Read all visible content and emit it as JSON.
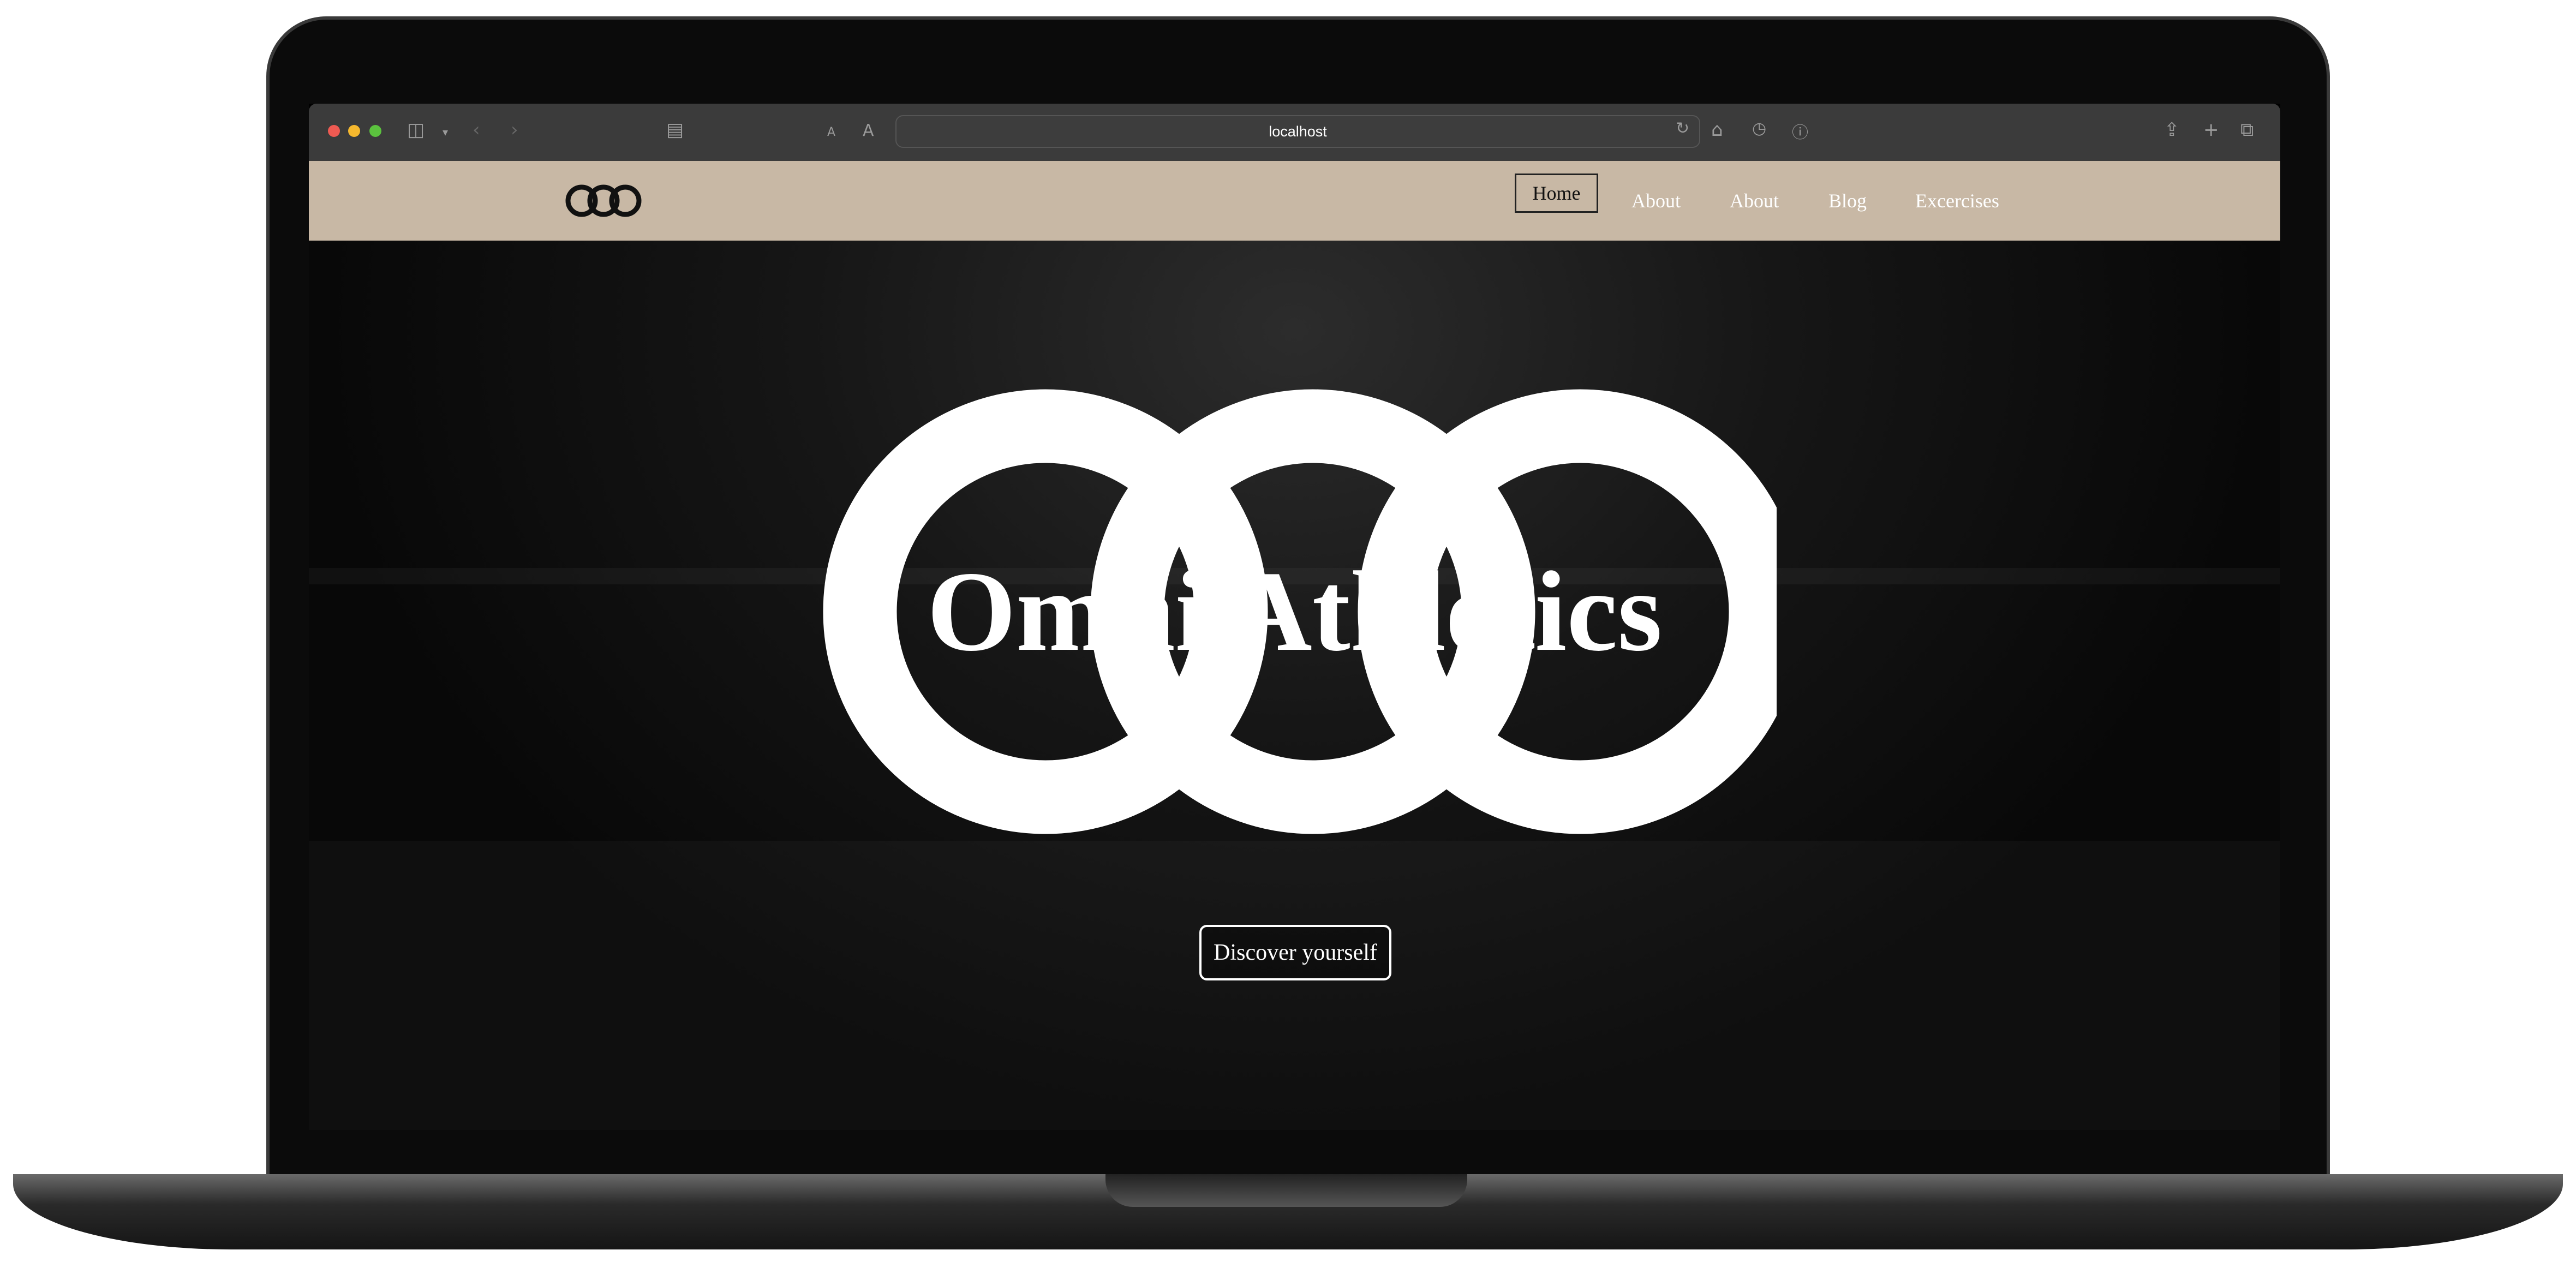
{
  "browser": {
    "url": "localhost",
    "text_size_small": "A",
    "text_size_large": "A"
  },
  "nav": {
    "items": [
      {
        "label": "Home"
      },
      {
        "label": "About"
      },
      {
        "label": "About"
      },
      {
        "label": "Blog"
      },
      {
        "label": "Excercises"
      }
    ]
  },
  "hero": {
    "title": "Omni Athletics",
    "cta": "Discover yourself"
  },
  "colors": {
    "nav_bg": "#c8b8a5",
    "toolbar_bg": "#3b3b3b"
  }
}
